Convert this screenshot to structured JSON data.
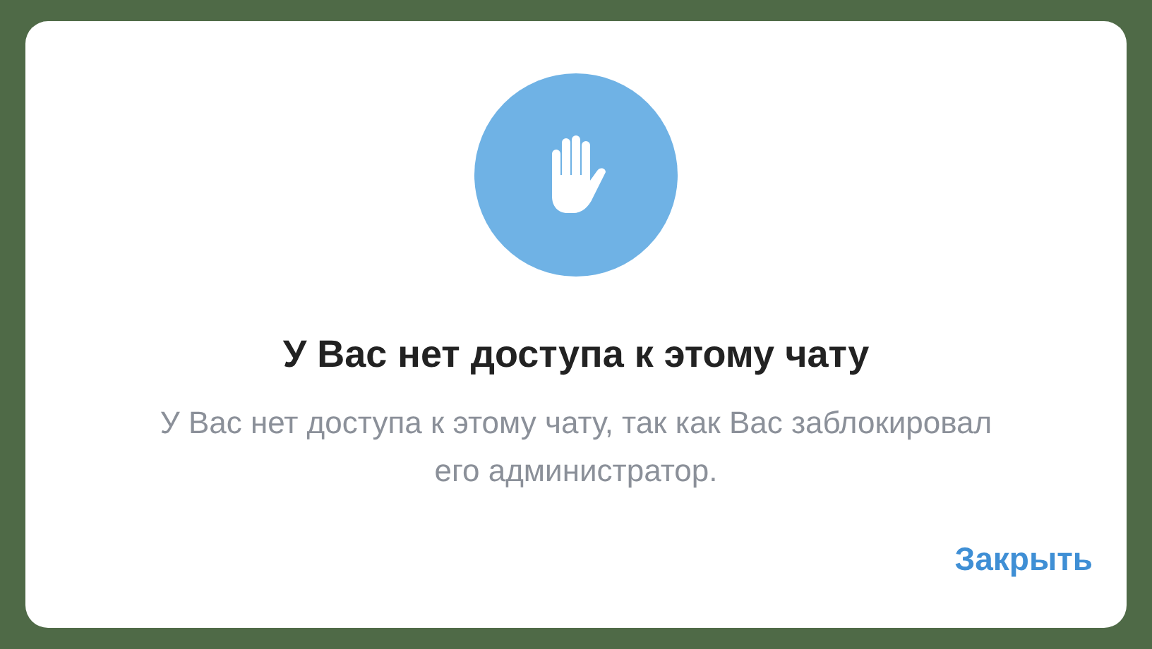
{
  "dialog": {
    "title": "У Вас нет доступа к этому чату",
    "message": "У Вас нет доступа к этому чату, так как Вас заблокировал его администратор.",
    "buttons": [
      "Закрыть"
    ]
  }
}
